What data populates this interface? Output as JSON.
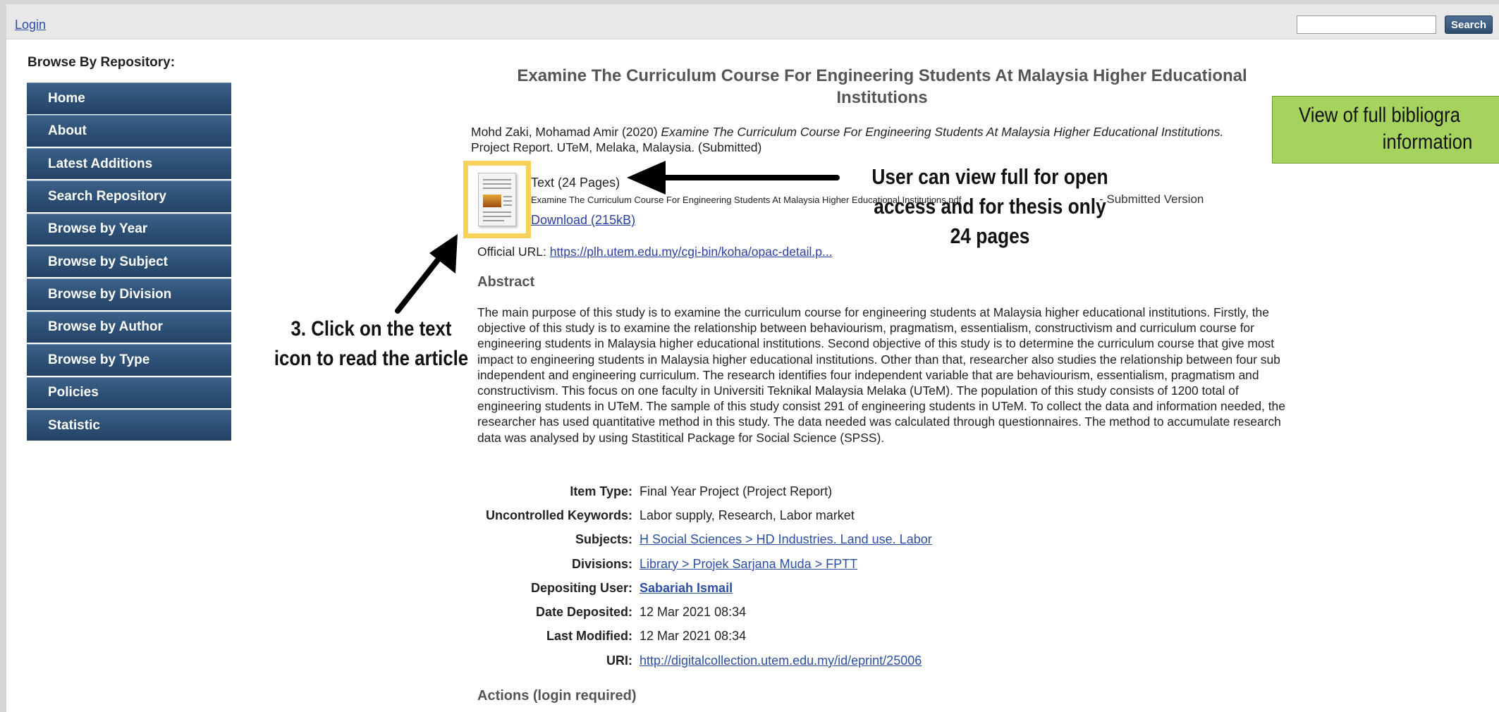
{
  "topbar": {
    "login_label": "Login",
    "search_placeholder": "",
    "search_button_label": "Search"
  },
  "sidebar": {
    "heading": "Browse By Repository:",
    "items": [
      {
        "label": "Home"
      },
      {
        "label": "About"
      },
      {
        "label": "Latest Additions"
      },
      {
        "label": "Search Repository"
      },
      {
        "label": "Browse by Year"
      },
      {
        "label": "Browse by Subject"
      },
      {
        "label": "Browse by Division"
      },
      {
        "label": "Browse by Author"
      },
      {
        "label": "Browse by Type"
      },
      {
        "label": "Policies"
      },
      {
        "label": "Statistic"
      }
    ]
  },
  "record": {
    "title": "Examine The Curriculum Course For Engineering Students At Malaysia Higher Educational Institutions",
    "citation_authors": "Mohd Zaki, Mohamad Amir (2020) ",
    "citation_title": "Examine The Curriculum Course For Engineering Students At Malaysia Higher Educational Institutions.",
    "citation_rest": " Project Report. UTeM, Melaka, Malaysia. (Submitted)",
    "file": {
      "type_label": "Text (24 Pages)",
      "file_name": "Examine The Curriculum Course For Engineering Students At Malaysia Higher Educational Institutions.pdf",
      "version": " - Submitted Version",
      "download_label": "Download (215kB)"
    },
    "official_url_label": "Official URL: ",
    "official_url": "https://plh.utem.edu.my/cgi-bin/koha/opac-detail.p...",
    "abstract_heading": "Abstract",
    "abstract": "The main purpose of this study is to examine the curriculum course for engineering students at Malaysia higher educational institutions. Firstly, the objective of this study is to examine the relationship between behaviourism, pragmatism, essentialism, constructivism and curriculum course for engineering students in Malaysia higher educational institutions. Second objective of this study is to determine the curriculum course that give most impact to engineering students in Malaysia higher educational institutions. Other than that, researcher also studies the relationship between four sub independent and engineering curriculum. The research identifies four independent variable that are behaviourism, essentialism, pragmatism and constructivism. This focus on one faculty in Universiti Teknikal Malaysia Melaka (UTeM). The population of this study consists of 1200 total of engineering students in UTeM. The sample of this study consist 291 of engineering students in UTeM. To collect the data and information needed, the researcher has used quantitative method in this study. The data needed was calculated through questionnaires. The method to accumulate research data was analysed by using Stastitical Package for Social Science (SPSS).",
    "details": {
      "item_type_label": "Item Type:",
      "item_type": "Final Year Project (Project Report)",
      "keywords_label": "Uncontrolled Keywords:",
      "keywords": "Labor supply, Research, Labor market",
      "subjects_label": "Subjects:",
      "subjects": "H Social Sciences > HD Industries. Land use. Labor",
      "divisions_label": "Divisions:",
      "divisions": "Library > Projek Sarjana Muda > FPTT",
      "depositing_user_label": "Depositing User:",
      "depositing_user": "Sabariah Ismail",
      "date_deposited_label": "Date Deposited:",
      "date_deposited": "12 Mar 2021 08:34",
      "last_modified_label": "Last Modified:",
      "last_modified": "12 Mar 2021 08:34",
      "uri_label": "URI:",
      "uri": "http://digitalcollection.utem.edu.my/id/eprint/25006"
    },
    "actions_heading": "Actions (login required)"
  },
  "annotations": {
    "user_view_line1": "User can view full for open",
    "user_view_line2": "access and for thesis only",
    "user_view_line3": "24 pages",
    "click_icon_line1": "3. Click on the text",
    "click_icon_line2": "icon to read the article",
    "green_box_line1": "View of full bibliogra",
    "green_box_line2": "information",
    "green_box_color": "#a6d35e",
    "highlight_color": "#f6d15b"
  },
  "colors": {
    "nav_bg": "#2e5075",
    "link": "#2c4fa3",
    "title_gray": "#555555"
  }
}
